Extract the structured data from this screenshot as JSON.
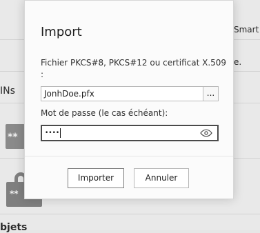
{
  "background": {
    "pins_label": "INs",
    "smart_label": "Smart",
    "dot_label": "e.",
    "objects_label": "bjets",
    "icon_text_1": "**",
    "icon_text_2": "**"
  },
  "dialog": {
    "title": "Import",
    "file_label_line1": "Fichier PKCS#8, PKCS#12 ou certificat X.509",
    "file_label_line2": ":",
    "file_value": "JonhDoe.pfx",
    "browse_label": "...",
    "password_label": "Mot de passe (le cas échéant):",
    "password_value": "••••",
    "buttons": {
      "import": "Importer",
      "cancel": "Annuler"
    }
  },
  "icons": {
    "eye": "eye-icon",
    "pin": "pin-icon",
    "lock": "lock-icon"
  },
  "colors": {
    "dialog_bg": "#fbfbfb",
    "field_border": "#b9b9b9",
    "focus_border": "#4a4a4a"
  }
}
